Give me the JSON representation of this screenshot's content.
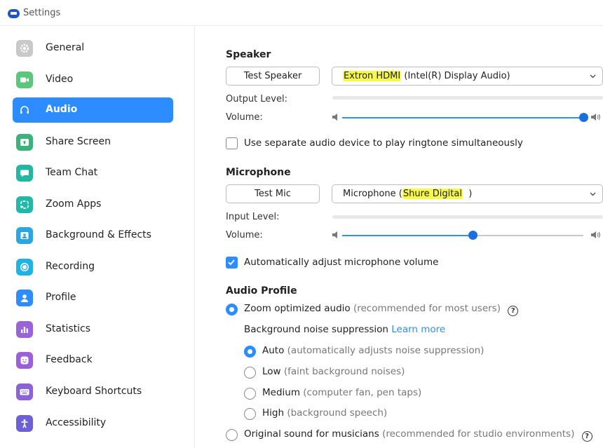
{
  "window": {
    "title": "Settings"
  },
  "colors": {
    "accent": "#2d8cff",
    "highlight": "#f6f84a"
  },
  "sidebar": {
    "items": [
      {
        "label": "General",
        "icon": "gear-icon",
        "color": "#c9c9c9"
      },
      {
        "label": "Video",
        "icon": "video-camera-icon",
        "color": "#5cc77a"
      },
      {
        "label": "Audio",
        "icon": "headphones-icon",
        "color": "#2d8cff",
        "active": true
      },
      {
        "label": "Share Screen",
        "icon": "share-screen-icon",
        "color": "#3bb27a"
      },
      {
        "label": "Team Chat",
        "icon": "chat-bubble-icon",
        "color": "#23b6a0"
      },
      {
        "label": "Zoom Apps",
        "icon": "apps-icon",
        "color": "#22b8a7"
      },
      {
        "label": "Background & Effects",
        "icon": "portrait-icon",
        "color": "#2aa7e0"
      },
      {
        "label": "Recording",
        "icon": "record-icon",
        "color": "#1fb3e3"
      },
      {
        "label": "Profile",
        "icon": "person-icon",
        "color": "#2d8cff"
      },
      {
        "label": "Statistics",
        "icon": "bar-chart-icon",
        "color": "#9a63d8"
      },
      {
        "label": "Feedback",
        "icon": "smiley-icon",
        "color": "#9b5fd8"
      },
      {
        "label": "Keyboard Shortcuts",
        "icon": "keyboard-icon",
        "color": "#8b63d6"
      },
      {
        "label": "Accessibility",
        "icon": "accessibility-icon",
        "color": "#6e5fd4"
      }
    ]
  },
  "speaker": {
    "title": "Speaker",
    "test_button": "Test Speaker",
    "device_highlight": "Extron HDMI",
    "device_rest": " (Intel(R) Display Audio)",
    "output_level_label": "Output Level:",
    "volume_label": "Volume:",
    "volume_level": 1.0
  },
  "ringtone": {
    "label": "Use separate audio device to play ringtone simultaneously",
    "checked": false
  },
  "microphone": {
    "title": "Microphone",
    "test_button": "Test Mic",
    "device_prefix": "Microphone (",
    "device_highlight": "Shure Digital",
    "device_suffix": "  )",
    "input_level_label": "Input Level:",
    "volume_label": "Volume:",
    "volume_level": 0.54
  },
  "auto_adjust": {
    "label": "Automatically adjust microphone volume",
    "checked": true
  },
  "audio_profile": {
    "title": "Audio Profile",
    "zoom_optimized": {
      "label": "Zoom optimized audio",
      "hint": "(recommended for most users)",
      "selected": true
    },
    "noise_suppression": {
      "label": "Background noise suppression",
      "link": "Learn more"
    },
    "options": [
      {
        "label": "Auto",
        "hint": "(automatically adjusts noise suppression)",
        "selected": true
      },
      {
        "label": "Low",
        "hint": "(faint background noises)",
        "selected": false
      },
      {
        "label": "Medium",
        "hint": "(computer fan, pen taps)",
        "selected": false
      },
      {
        "label": "High",
        "hint": "(background speech)",
        "selected": false
      }
    ],
    "original_sound": {
      "label": "Original sound for musicians",
      "hint": "(recommended for studio environments)",
      "selected": false
    },
    "help_glyph": "?"
  }
}
